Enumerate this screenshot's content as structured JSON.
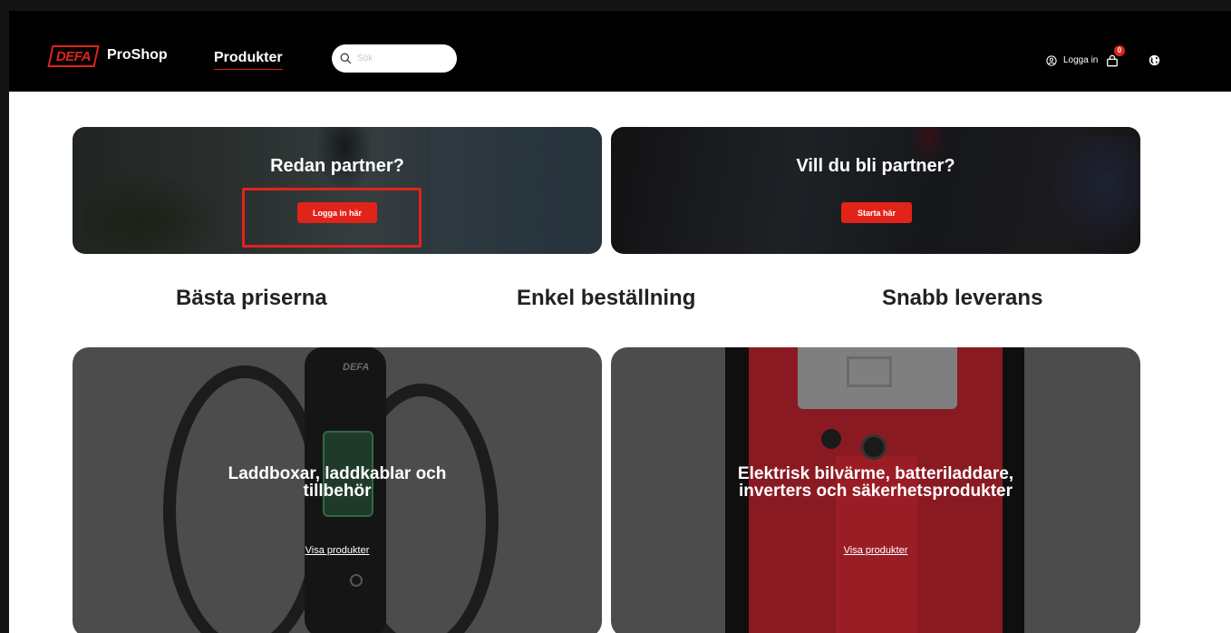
{
  "header": {
    "logo_text": "DEFA",
    "brand": "ProShop",
    "nav_products": "Produkter",
    "search_placeholder": "Sök",
    "login": "Logga in",
    "cart_count": "0"
  },
  "banners": [
    {
      "title": "Redan partner?",
      "button": "Logga in här"
    },
    {
      "title": "Vill du bli partner?",
      "button": "Starta här"
    }
  ],
  "features": [
    "Bästa priserna",
    "Enkel beställning",
    "Snabb leverans"
  ],
  "categories": [
    {
      "title_line1": "Laddboxar, laddkablar och",
      "title_line2": "tillbehör",
      "link": "Visa produkter"
    },
    {
      "title_line1": "Elektrisk bilvärme, batteriladdare,",
      "title_line2": "inverters och säkerhetsprodukter",
      "link": "Visa produkter"
    }
  ],
  "colors": {
    "accent": "#e2231a",
    "header_bg": "#000000",
    "card_bg": "#4c4c4c"
  },
  "icons": [
    "search-icon",
    "user-icon",
    "cart-icon",
    "globe-icon"
  ]
}
